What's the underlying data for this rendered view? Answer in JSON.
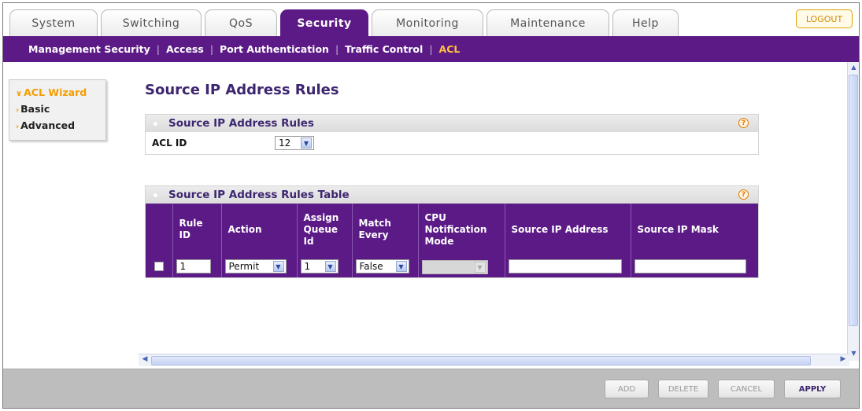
{
  "tabs": [
    {
      "label": "System",
      "active": false
    },
    {
      "label": "Switching",
      "active": false
    },
    {
      "label": "QoS",
      "active": false
    },
    {
      "label": "Security",
      "active": true
    },
    {
      "label": "Monitoring",
      "active": false
    },
    {
      "label": "Maintenance",
      "active": false
    },
    {
      "label": "Help",
      "active": false
    }
  ],
  "logout_label": "LOGOUT",
  "subnav": {
    "items": [
      "Management Security",
      "Access",
      "Port Authentication",
      "Traffic Control",
      "ACL"
    ],
    "current": "ACL"
  },
  "leftmenu": {
    "items": [
      "ACL Wizard",
      "Basic",
      "Advanced"
    ],
    "current": "ACL Wizard"
  },
  "page_title": "Source IP Address Rules",
  "acl_panel": {
    "title": "Source IP Address Rules",
    "acl_id_label": "ACL ID",
    "acl_id_value": "12"
  },
  "table_panel": {
    "title": "Source IP Address Rules Table",
    "columns": [
      "Rule ID",
      "Action",
      "Assign Queue Id",
      "Match Every",
      "CPU Notification Mode",
      "Source IP Address",
      "Source IP Mask"
    ],
    "row": {
      "rule_id": "1",
      "action": "Permit",
      "queue_id": "1",
      "match_every": "False",
      "cpu_mode": "",
      "source_ip": "",
      "source_mask": ""
    }
  },
  "buttons": {
    "add": "ADD",
    "delete": "DELETE",
    "cancel": "CANCEL",
    "apply": "APPLY"
  },
  "colors": {
    "brand_purple": "#5c1a86",
    "accent_orange": "#f59d00"
  }
}
